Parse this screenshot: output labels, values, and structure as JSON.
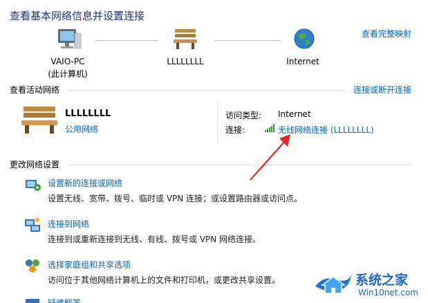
{
  "header": {
    "title": "查看基本网络信息并设置连接",
    "map_link": "查看完整映射"
  },
  "map": {
    "pc": {
      "name": "VAIO-PC",
      "sub": "(此计算机)"
    },
    "network": {
      "name": "LLLLLLLL"
    },
    "internet": {
      "name": "Internet"
    }
  },
  "active": {
    "section_title": "查看活动网络",
    "connect_link": "连接或断开连接",
    "network_name": "LLLLLLLL",
    "network_type": "公用网络",
    "access_label": "访问类型:",
    "access_value": "Internet",
    "conn_label": "连接:",
    "conn_value": "无线网络连接 (LLLLLLLL)"
  },
  "change": {
    "section_title": "更改网络设置",
    "tasks": [
      {
        "title": "设置新的连接或网络",
        "desc": "设置无线、宽带、拨号、临时或 VPN 连接；或设置路由器或访问点。"
      },
      {
        "title": "连接到网络",
        "desc": "连接到或重新连接到无线、有线、拨号或 VPN 网络连接。"
      },
      {
        "title": "选择家庭组和共享选项",
        "desc": "访问位于其他网络计算机上的文件和打印机，或更改共享设置。"
      },
      {
        "title": "疑难解答"
      }
    ]
  },
  "watermark": {
    "brand": "系统之家",
    "site": "Win10net.com"
  },
  "colors": {
    "title": "#1e3287",
    "link": "#0066cc",
    "arrow": "#e5261e",
    "signal": "#3a9a2f"
  }
}
